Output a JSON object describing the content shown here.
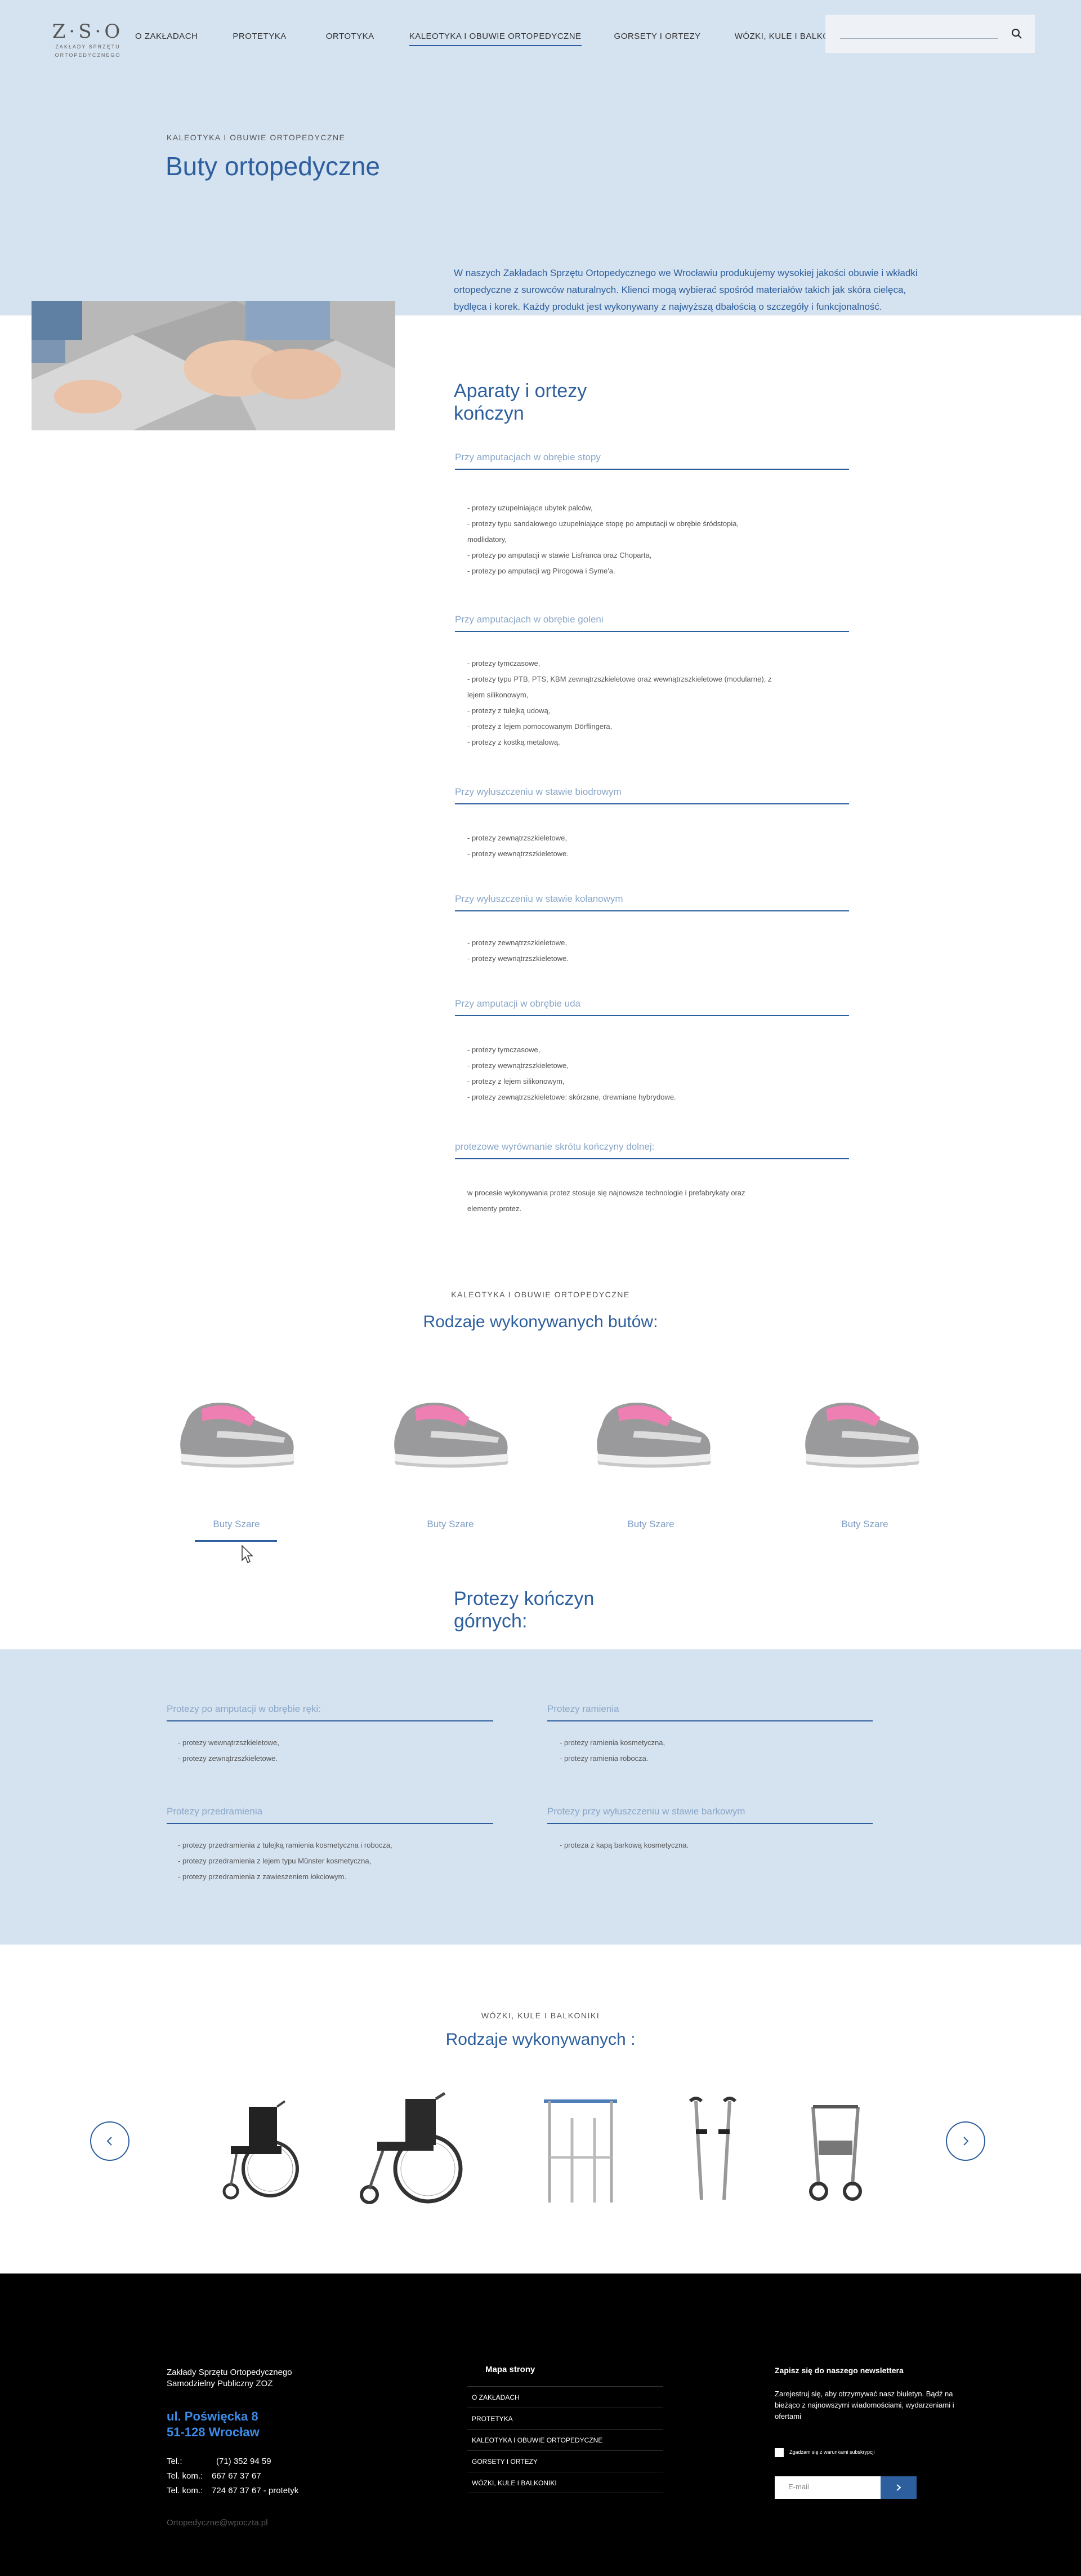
{
  "header": {
    "logo_mark": "Z·S·O",
    "logo_sub1": "ZAKŁADY SPRZĘTU",
    "logo_sub2": "ORTOPEDYCZNEGO",
    "nav": [
      {
        "label": "O ZAKŁADACH",
        "active": false
      },
      {
        "label": "PROTETYKA",
        "active": false
      },
      {
        "label": "ORTOTYKA",
        "active": false
      },
      {
        "label": "KALEOTYKA I OBUWIE ORTOPEDYCZNE",
        "active": true
      },
      {
        "label": "GORSETY I ORTEZY",
        "active": false
      },
      {
        "label": "WÓZKI, KULE I BALKONIKI",
        "active": false
      }
    ],
    "search_icon": "search-icon"
  },
  "hero": {
    "category": "KALEOTYKA I OBUWIE ORTOPEDYCZNE",
    "title": "Buty ortopedyczne",
    "paragraph": "W naszych Zakładach Sprzętu Ortopedycznego we Wrocławiu produkujemy wysokiej jakości obuwie i wkładki ortopedyczne z surowców naturalnych. Klienci mogą wybierać spośród materiałów takich jak skóra cielęca, bydlęca i korek. Każdy produkt jest wykonywany z najwyższą dbałością o szczegóły i funkcjonalność."
  },
  "lower_limbs": {
    "title_line1": "Aparaty i ortezy",
    "title_line2": "kończyn",
    "groups": [
      {
        "heading": "Przy amputacjach w obrębie stopy",
        "items": [
          "- protezy uzupełniające ubytek palców,",
          "- protezy typu sandałowego uzupełniające stopę po amputacji w obrębie śródstopia,",
          "  modlidatory,",
          "- protezy po amputacji w stawie Lisfranca oraz Choparta,",
          "- protezy po amputacji wg Pirogowa i Syme'a."
        ]
      },
      {
        "heading": "Przy amputacjach w obrębie goleni",
        "items": [
          "- protezy tymczasowe,",
          "- protezy typu PTB, PTS, KBM zewnątrzszkieletowe oraz wewnątrzszkieletowe (modularne), z",
          "  lejem silikonowym,",
          "- protezy z tulejką udową,",
          "- protezy z lejem pomocowanym Dörflingera,",
          "- protezy z kostką metalową."
        ]
      },
      {
        "heading": "Przy wyłuszczeniu w stawie biodrowym",
        "items": [
          "- protezy zewnątrzszkieletowe,",
          "- protezy wewnątrzszkieletowe."
        ]
      },
      {
        "heading": "Przy wyłuszczeniu w stawie kolanowym",
        "items": [
          "- protezy zewnątrzszkieletowe,",
          "- protezy wewnątrzszkieletowe."
        ]
      },
      {
        "heading": "Przy amputacji w obrębie uda",
        "items": [
          "- protezy tymczasowe,",
          "- protezy wewnątrzszkieletowe,",
          "- protezy z lejem silikonowym,",
          "- protezy zewnątrzszkieletowe: skórzane, drewniane hybrydowe."
        ]
      },
      {
        "heading": "protezowe wyrównanie skrótu kończyny dolnej:",
        "items": [
          "w procesie wykonywania protez stosuje się najnowsze technologie i prefabrykaty oraz",
          "elementy protez."
        ]
      }
    ]
  },
  "shoes": {
    "category": "KALEOTYKA I OBUWIE ORTOPEDYCZNE",
    "title": "Rodzaje wykonywanych butów:",
    "items": [
      "Buty Szare",
      "Buty Szare",
      "Buty Szare",
      "Buty Szare"
    ]
  },
  "upper_limbs": {
    "title_line1": "Protezy kończyn",
    "title_line2": "górnych:",
    "groups": [
      {
        "heading": "Protezy po amputacji w obrębie ręki:",
        "items": [
          "- protezy wewnątrzszkieletowe,",
          "- protezy zewnątrzszkieletowe."
        ]
      },
      {
        "heading": "Protezy ramienia",
        "items": [
          "- protezy ramienia kosmetyczna,",
          "- protezy ramienia robocza."
        ]
      },
      {
        "heading": "Protezy przedramienia",
        "items": [
          "- protezy przedramienia z tulejką ramienia kosmetyczna i robocza,",
          "- protezy przedramienia z lejem typu Münster kosmetyczna,",
          "- protezy przedramienia z zawieszeniem łokciowym."
        ]
      },
      {
        "heading": "Protezy przy wyłuszczeniu w stawie barkowym",
        "items": [
          "- proteza z kapą barkową kosmetyczna."
        ]
      }
    ]
  },
  "mobility": {
    "category": "WÓZKI, KULE I BALKONIKI",
    "title": "Rodzaje wykonywanych :",
    "prev_icon": "chevron-left-icon",
    "next_icon": "chevron-right-icon"
  },
  "footer": {
    "company_line1": "Zakłady Sprzętu Ortopedycznego",
    "company_line2": "Samodzielny Publiczny ZOZ",
    "street": "ul. Poświęcka 8",
    "city": "51-128 Wrocław",
    "phone_label": "Tel.:",
    "phone_value": "(71) 352 94 59",
    "mobile1_label": "Tel. kom.:",
    "mobile1_value": "667 67 37 67",
    "mobile2_label": "Tel. kom.:",
    "mobile2_value": "724 67 37 67 - protetyk",
    "email": "Ortopedyczne@wpoczta.pl",
    "sitemap_title": "Mapa strony",
    "sitemap": [
      "O ZAKŁADACH",
      "PROTETYKA",
      "KALEOTYKA I OBUWIE ORTOPEDYCZNE",
      "GORSETY I ORTEZY",
      "WÓZKI, KULE I BALKONIKI"
    ],
    "newsletter_title": "Zapisz się do naszego newslettera",
    "newsletter_text": "Zarejestruj się, aby otrzymywać nasz biuletyn. Bądź na bieżąco z najnowszymi wiadomościami, wydarzeniami i ofertami",
    "consent": "Zgadzam się z warunkami subskrypcji",
    "email_placeholder": "E-mail",
    "submit_icon": "chevron-right-icon"
  },
  "colors": {
    "primary": "#2d5f9e",
    "band": "#d5e2ef",
    "footer": "#000000",
    "link": "#3a8be8"
  }
}
